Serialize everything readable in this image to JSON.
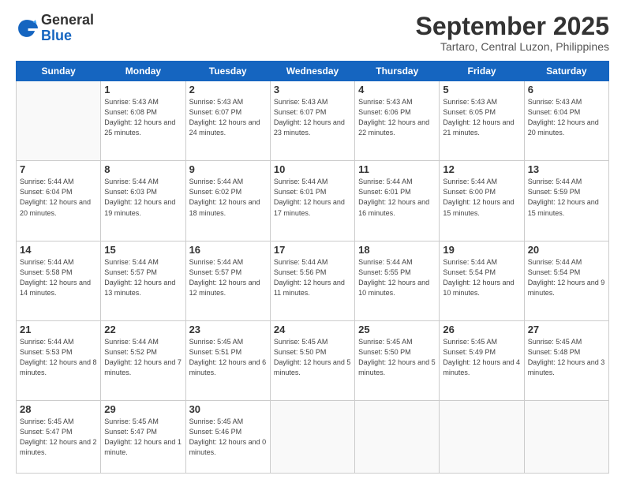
{
  "header": {
    "logo_general": "General",
    "logo_blue": "Blue",
    "month_title": "September 2025",
    "location": "Tartaro, Central Luzon, Philippines"
  },
  "weekdays": [
    "Sunday",
    "Monday",
    "Tuesday",
    "Wednesday",
    "Thursday",
    "Friday",
    "Saturday"
  ],
  "weeks": [
    [
      {
        "day": "",
        "info": ""
      },
      {
        "day": "1",
        "info": "Sunrise: 5:43 AM\nSunset: 6:08 PM\nDaylight: 12 hours\nand 25 minutes."
      },
      {
        "day": "2",
        "info": "Sunrise: 5:43 AM\nSunset: 6:07 PM\nDaylight: 12 hours\nand 24 minutes."
      },
      {
        "day": "3",
        "info": "Sunrise: 5:43 AM\nSunset: 6:07 PM\nDaylight: 12 hours\nand 23 minutes."
      },
      {
        "day": "4",
        "info": "Sunrise: 5:43 AM\nSunset: 6:06 PM\nDaylight: 12 hours\nand 22 minutes."
      },
      {
        "day": "5",
        "info": "Sunrise: 5:43 AM\nSunset: 6:05 PM\nDaylight: 12 hours\nand 21 minutes."
      },
      {
        "day": "6",
        "info": "Sunrise: 5:43 AM\nSunset: 6:04 PM\nDaylight: 12 hours\nand 20 minutes."
      }
    ],
    [
      {
        "day": "7",
        "info": "Sunrise: 5:44 AM\nSunset: 6:04 PM\nDaylight: 12 hours\nand 20 minutes."
      },
      {
        "day": "8",
        "info": "Sunrise: 5:44 AM\nSunset: 6:03 PM\nDaylight: 12 hours\nand 19 minutes."
      },
      {
        "day": "9",
        "info": "Sunrise: 5:44 AM\nSunset: 6:02 PM\nDaylight: 12 hours\nand 18 minutes."
      },
      {
        "day": "10",
        "info": "Sunrise: 5:44 AM\nSunset: 6:01 PM\nDaylight: 12 hours\nand 17 minutes."
      },
      {
        "day": "11",
        "info": "Sunrise: 5:44 AM\nSunset: 6:01 PM\nDaylight: 12 hours\nand 16 minutes."
      },
      {
        "day": "12",
        "info": "Sunrise: 5:44 AM\nSunset: 6:00 PM\nDaylight: 12 hours\nand 15 minutes."
      },
      {
        "day": "13",
        "info": "Sunrise: 5:44 AM\nSunset: 5:59 PM\nDaylight: 12 hours\nand 15 minutes."
      }
    ],
    [
      {
        "day": "14",
        "info": "Sunrise: 5:44 AM\nSunset: 5:58 PM\nDaylight: 12 hours\nand 14 minutes."
      },
      {
        "day": "15",
        "info": "Sunrise: 5:44 AM\nSunset: 5:57 PM\nDaylight: 12 hours\nand 13 minutes."
      },
      {
        "day": "16",
        "info": "Sunrise: 5:44 AM\nSunset: 5:57 PM\nDaylight: 12 hours\nand 12 minutes."
      },
      {
        "day": "17",
        "info": "Sunrise: 5:44 AM\nSunset: 5:56 PM\nDaylight: 12 hours\nand 11 minutes."
      },
      {
        "day": "18",
        "info": "Sunrise: 5:44 AM\nSunset: 5:55 PM\nDaylight: 12 hours\nand 10 minutes."
      },
      {
        "day": "19",
        "info": "Sunrise: 5:44 AM\nSunset: 5:54 PM\nDaylight: 12 hours\nand 10 minutes."
      },
      {
        "day": "20",
        "info": "Sunrise: 5:44 AM\nSunset: 5:54 PM\nDaylight: 12 hours\nand 9 minutes."
      }
    ],
    [
      {
        "day": "21",
        "info": "Sunrise: 5:44 AM\nSunset: 5:53 PM\nDaylight: 12 hours\nand 8 minutes."
      },
      {
        "day": "22",
        "info": "Sunrise: 5:44 AM\nSunset: 5:52 PM\nDaylight: 12 hours\nand 7 minutes."
      },
      {
        "day": "23",
        "info": "Sunrise: 5:45 AM\nSunset: 5:51 PM\nDaylight: 12 hours\nand 6 minutes."
      },
      {
        "day": "24",
        "info": "Sunrise: 5:45 AM\nSunset: 5:50 PM\nDaylight: 12 hours\nand 5 minutes."
      },
      {
        "day": "25",
        "info": "Sunrise: 5:45 AM\nSunset: 5:50 PM\nDaylight: 12 hours\nand 5 minutes."
      },
      {
        "day": "26",
        "info": "Sunrise: 5:45 AM\nSunset: 5:49 PM\nDaylight: 12 hours\nand 4 minutes."
      },
      {
        "day": "27",
        "info": "Sunrise: 5:45 AM\nSunset: 5:48 PM\nDaylight: 12 hours\nand 3 minutes."
      }
    ],
    [
      {
        "day": "28",
        "info": "Sunrise: 5:45 AM\nSunset: 5:47 PM\nDaylight: 12 hours\nand 2 minutes."
      },
      {
        "day": "29",
        "info": "Sunrise: 5:45 AM\nSunset: 5:47 PM\nDaylight: 12 hours\nand 1 minute."
      },
      {
        "day": "30",
        "info": "Sunrise: 5:45 AM\nSunset: 5:46 PM\nDaylight: 12 hours\nand 0 minutes."
      },
      {
        "day": "",
        "info": ""
      },
      {
        "day": "",
        "info": ""
      },
      {
        "day": "",
        "info": ""
      },
      {
        "day": "",
        "info": ""
      }
    ]
  ]
}
